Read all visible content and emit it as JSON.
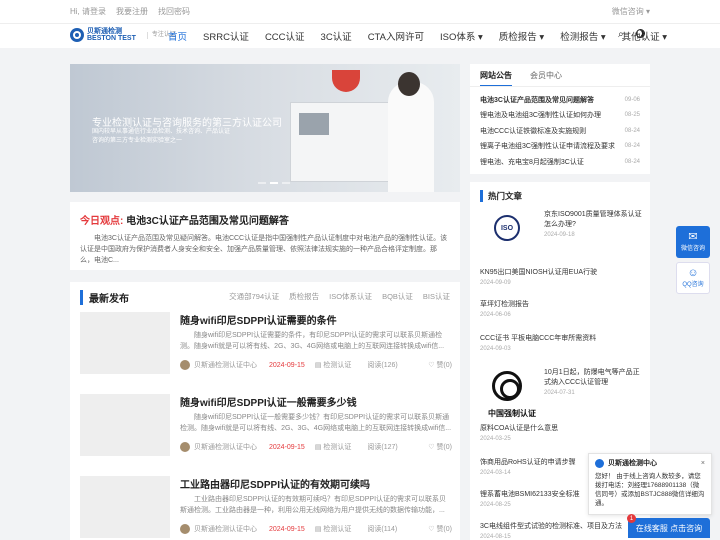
{
  "topbar": {
    "greeting": "Hi, 请登录",
    "register": "我要注册",
    "forgot": "找回密码",
    "wechat": "微信咨询"
  },
  "logo": {
    "cn": "贝斯通检测",
    "en": "BESTON TEST",
    "sub": "专注认证"
  },
  "nav": [
    "首页",
    "SRRC认证",
    "CCC认证",
    "3C认证",
    "CTA入网许可",
    "ISO体系",
    "质检报告",
    "检测报告",
    "其他认证"
  ],
  "banner": {
    "slogan": "专业检测认证与咨询服务的第三方认证公司",
    "small": "国内较早从事通信行业品检测、技术咨询、产品认证咨询的第三方专业检测实验室之一"
  },
  "featured": {
    "tag": "今日观点:",
    "title": "电池3C认证产品范围及常见问题解答",
    "desc": "电池3C认证产品范围及常见疑问解答。电池CCC认证是指中国强制性产品认证制度中对电池产品的强制性认证。该认证是中国政府为保护消费者人身安全和安全、加强产品质量管理、依照法律法规实施的一种产品合格评定制度。那么，电池C..."
  },
  "latest": {
    "title": "最新发布",
    "cats": [
      "交通部794认证",
      "质检报告",
      "ISO体系认证",
      "BQB认证",
      "BIS认证"
    ],
    "posts": [
      {
        "title": "随身wifi印尼SDPPI认证需要的条件",
        "excerpt": "随身wifi印尼SDPPI认证需要的条件，有印尼SDPPI认证的需求可以联系贝斯通检测。随身wifi就是可以将有线、2G、3G、4G网络或电脑上的互联网连接转换成wifi信...",
        "author": "贝斯通检测认证中心",
        "date": "2024-09-15",
        "cat": "检测认证",
        "read": "阅读(126)",
        "like": "赞(0)"
      },
      {
        "title": "随身wifi印尼SDPPI认证一般需要多少钱",
        "excerpt": "随身wifi印尼SDPPI认证一般需要多少钱？有印尼SDPPI认证的需求可以联系贝斯通检测。随身wifi就是可以将有线、2G、3G、4G网络或电脑上的互联网连接转换成wifi信...",
        "author": "贝斯通检测认证中心",
        "date": "2024-09-15",
        "cat": "检测认证",
        "read": "阅读(127)",
        "like": "赞(0)"
      },
      {
        "title": "工业路由器印尼SDPPI认证的有效期可续吗",
        "excerpt": "工业路由器印尼SDPPI认证的有效期可续吗？有印尼SDPPI认证的需求可以联系贝斯通检测。工业路由器是一种，利用公用无线网络为用户提供无线的数据传输功能，...",
        "author": "贝斯通检测认证中心",
        "date": "2024-09-15",
        "cat": "检测认证",
        "read": "阅读(114)",
        "like": "赞(0)"
      }
    ]
  },
  "notice": {
    "tabs": [
      "网站公告",
      "会员中心"
    ],
    "items": [
      {
        "t": "电池3C认证产品范围及常见问题解答",
        "d": "09-06"
      },
      {
        "t": "锂电池及电池组3C强制性认证如何办理",
        "d": "08-25"
      },
      {
        "t": "电池CCC认证铁徽标准及实施规则",
        "d": "08-24"
      },
      {
        "t": "锂离子电池组3C强制性认证申请流程及要求",
        "d": "08-24"
      },
      {
        "t": "锂电池、充电宝8月起强制3C认证",
        "d": "08-24"
      }
    ]
  },
  "hot": {
    "title": "热门文章",
    "items": [
      {
        "t": "京东ISO9001质量管理体系认证怎么办理?",
        "d": "2024-09-18",
        "img": "ISO"
      },
      {
        "t": "KN95出口美国NIOSH认证用EUA行驶",
        "d": "2024-09-09"
      },
      {
        "t": "草坪灯检测报告",
        "d": "2024-06-06"
      },
      {
        "t": "CCC证书 平板电脑CCC年审所需资料",
        "d": "2024-09-03"
      },
      {
        "t": "10月1日起，防爆电气等产品正式纳入CCC认证管理",
        "d": "2024-07-31",
        "img": "中国强制认证"
      },
      {
        "t": "原料COA认证是什么意思",
        "d": "2024-03-25"
      },
      {
        "t": "饰商用品RoHS认证的申请步骤",
        "d": "2024-03-14"
      },
      {
        "t": "锂系蓄电池BSMI62133安全标准",
        "d": "2024-08-25"
      },
      {
        "t": "3C电线组件型式试验的检测标准、项目及方法",
        "d": "2024-08-15"
      }
    ]
  },
  "float": {
    "wechat": "微信咨询",
    "qq": "QQ咨询"
  },
  "chat": {
    "name": "贝斯通检测中心",
    "close": "×",
    "msg": "您好！ 由于线上咨询人数较多，请您拨打电话：刘经理17688901138（微信同号）或添加BSTJC888微信详细沟通。",
    "cta": "在线客服 点击咨询",
    "badge": "1"
  }
}
